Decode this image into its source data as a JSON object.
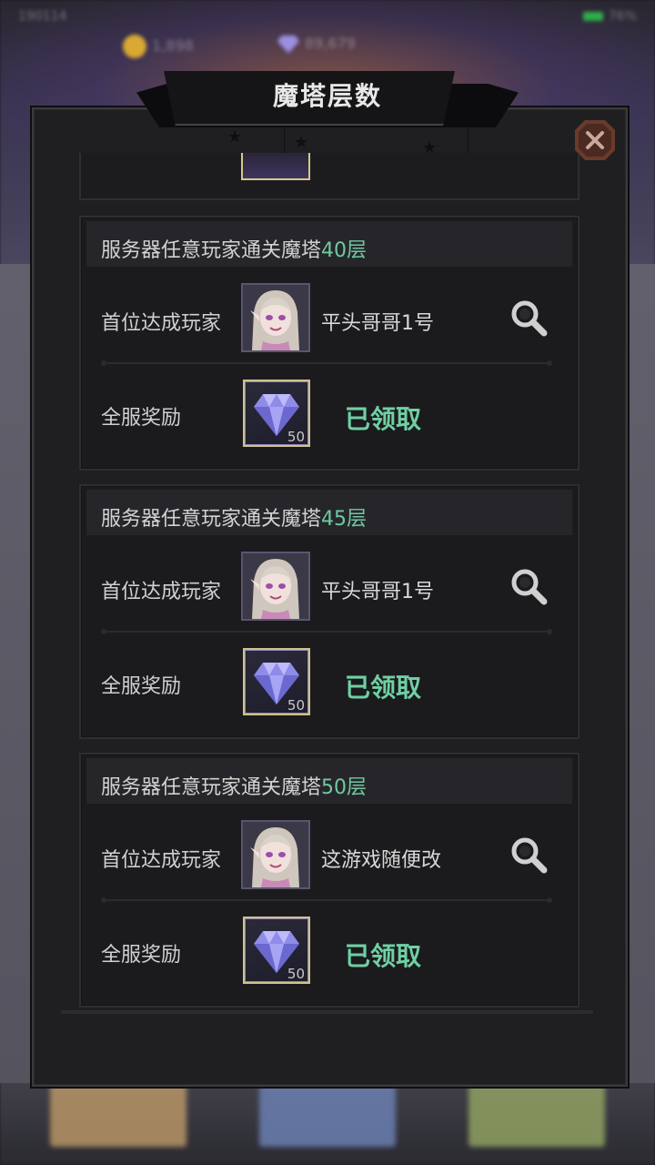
{
  "status_bar": {
    "left": "190114",
    "right": "76%"
  },
  "top_resources": {
    "gold": "1,898",
    "gems": "89,679"
  },
  "dialog": {
    "title": "魔塔层数",
    "close_icon": "close-x-icon"
  },
  "labels": {
    "first_player": "首位达成玩家",
    "server_reward": "全服奖励",
    "claimed": "已领取",
    "title_prefix": "服务器任意玩家通关魔塔",
    "floor_suffix": "层"
  },
  "records": [
    {
      "floor": "40",
      "player_name": "平头哥哥1号",
      "reward_count": "50",
      "status": "已领取"
    },
    {
      "floor": "45",
      "player_name": "平头哥哥1号",
      "reward_count": "50",
      "status": "已领取"
    },
    {
      "floor": "50",
      "player_name": "这游戏随便改",
      "reward_count": "50",
      "status": "已领取"
    }
  ],
  "colors": {
    "accent_green": "#6fc9a0",
    "frame_gold": "#cfc38a",
    "close_button": "#6b3a2c"
  }
}
